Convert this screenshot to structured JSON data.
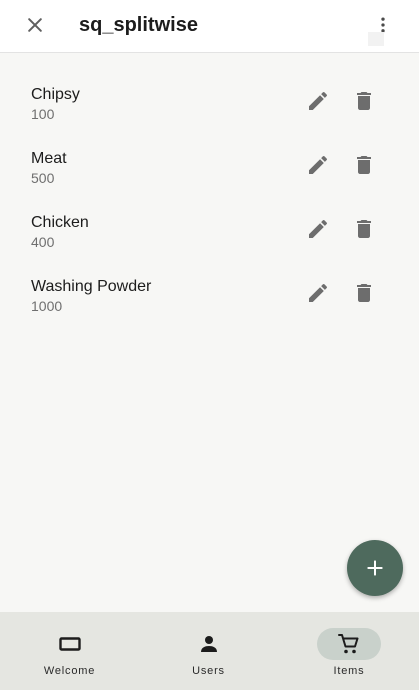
{
  "app": {
    "title": "sq_splitwise"
  },
  "icons": {
    "close": "close-icon",
    "more": "more-vert-icon",
    "edit": "pencil-icon",
    "delete": "trash-icon",
    "add": "plus-icon",
    "welcome": "rectangle-icon",
    "users": "person-icon",
    "items": "cart-icon"
  },
  "items": [
    {
      "name": "Chipsy",
      "price": "100"
    },
    {
      "name": "Meat",
      "price": "500"
    },
    {
      "name": "Chicken",
      "price": "400"
    },
    {
      "name": "Washing Powder",
      "price": "1000"
    }
  ],
  "nav": {
    "welcome": "Welcome",
    "users": "Users",
    "items": "Items",
    "selected": "Items"
  },
  "colors": {
    "fab": "#4e6a5d",
    "nav_background": "#e5e6e1",
    "nav_selected_pill": "#c9d1cb",
    "icon_grey": "#6d6d6d"
  }
}
